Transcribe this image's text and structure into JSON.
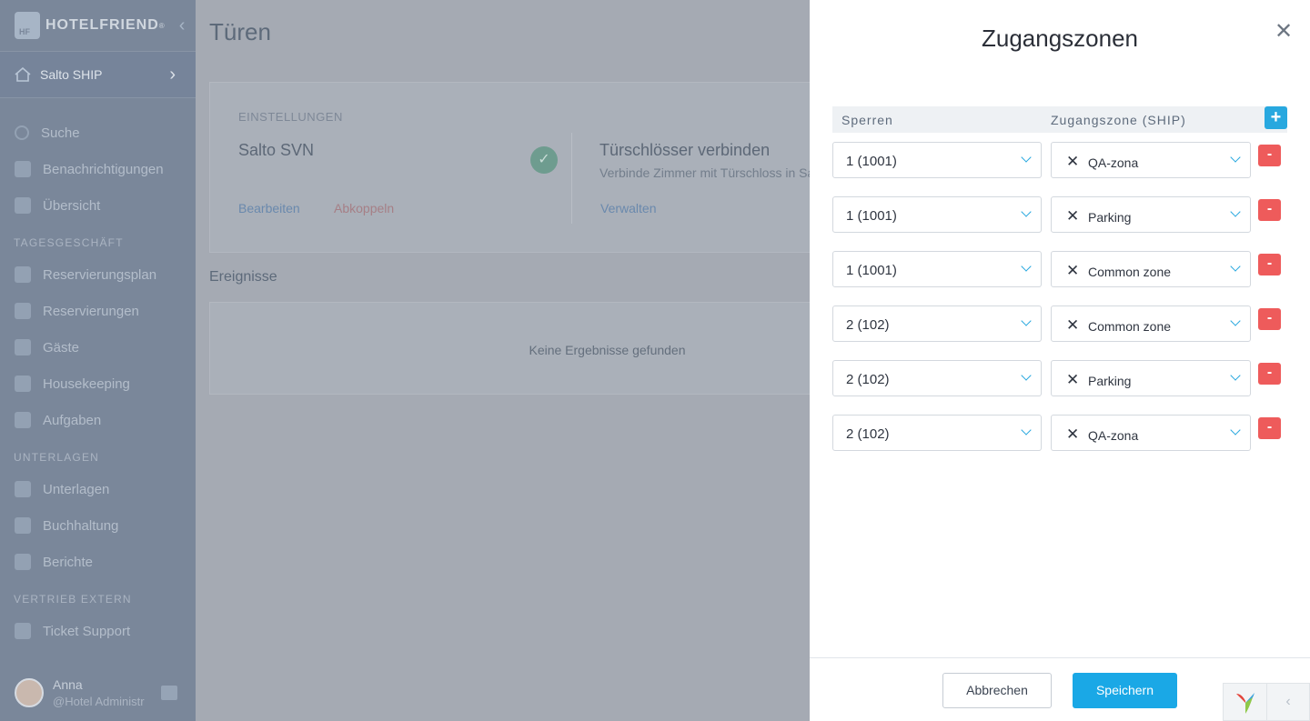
{
  "sidebar": {
    "brand": "HOTELFRIEND",
    "brand_mark": "®",
    "hotel": "Salto SHIP",
    "items": [
      {
        "label": "Suche"
      },
      {
        "label": "Benachrichtigungen"
      },
      {
        "label": "Übersicht"
      }
    ],
    "sections": [
      {
        "title": "TAGESGESCHÄFT",
        "items": [
          "Reservierungsplan",
          "Reservierungen",
          "Gäste",
          "Housekeeping",
          "Aufgaben"
        ]
      },
      {
        "title": "UNTERLAGEN",
        "items": [
          "Unterlagen",
          "Buchhaltung",
          "Berichte"
        ]
      },
      {
        "title": "VERTRIEB EXTERN",
        "items": [
          "Ticket Support"
        ]
      }
    ],
    "user": {
      "name": "Anna",
      "role": "@Hotel Administr"
    }
  },
  "main": {
    "title": "Türen",
    "settings": {
      "label": "EINSTELLUNGEN",
      "name": "Salto SVN",
      "edit": "Bearbeiten",
      "disconnect": "Abkoppeln",
      "connect_title": "Türschlösser verbinden",
      "connect_sub": "Verbinde Zimmer mit Türschloss in Sa",
      "manage": "Verwalten"
    },
    "events_title": "Ereignisse",
    "events_empty": "Keine Ergebnisse gefunden"
  },
  "drawer": {
    "title": "Zugangszonen",
    "col_lock": "Sperren",
    "col_zone": "Zugangszone (SHIP)",
    "add_label": "+",
    "remove_label": "-",
    "rows": [
      {
        "lock": "1 (1001)",
        "zone": "QA-zona"
      },
      {
        "lock": "1 (1001)",
        "zone": "Parking"
      },
      {
        "lock": "1 (1001)",
        "zone": "Common zone"
      },
      {
        "lock": "2 (102)",
        "zone": "Common zone"
      },
      {
        "lock": "2 (102)",
        "zone": "Parking"
      },
      {
        "lock": "2 (102)",
        "zone": "QA-zona"
      }
    ],
    "cancel": "Abbrechen",
    "save": "Speichern"
  },
  "colors": {
    "accent": "#1aa8e6",
    "danger": "#ee5b5b",
    "overlay": "#a5aab3"
  }
}
